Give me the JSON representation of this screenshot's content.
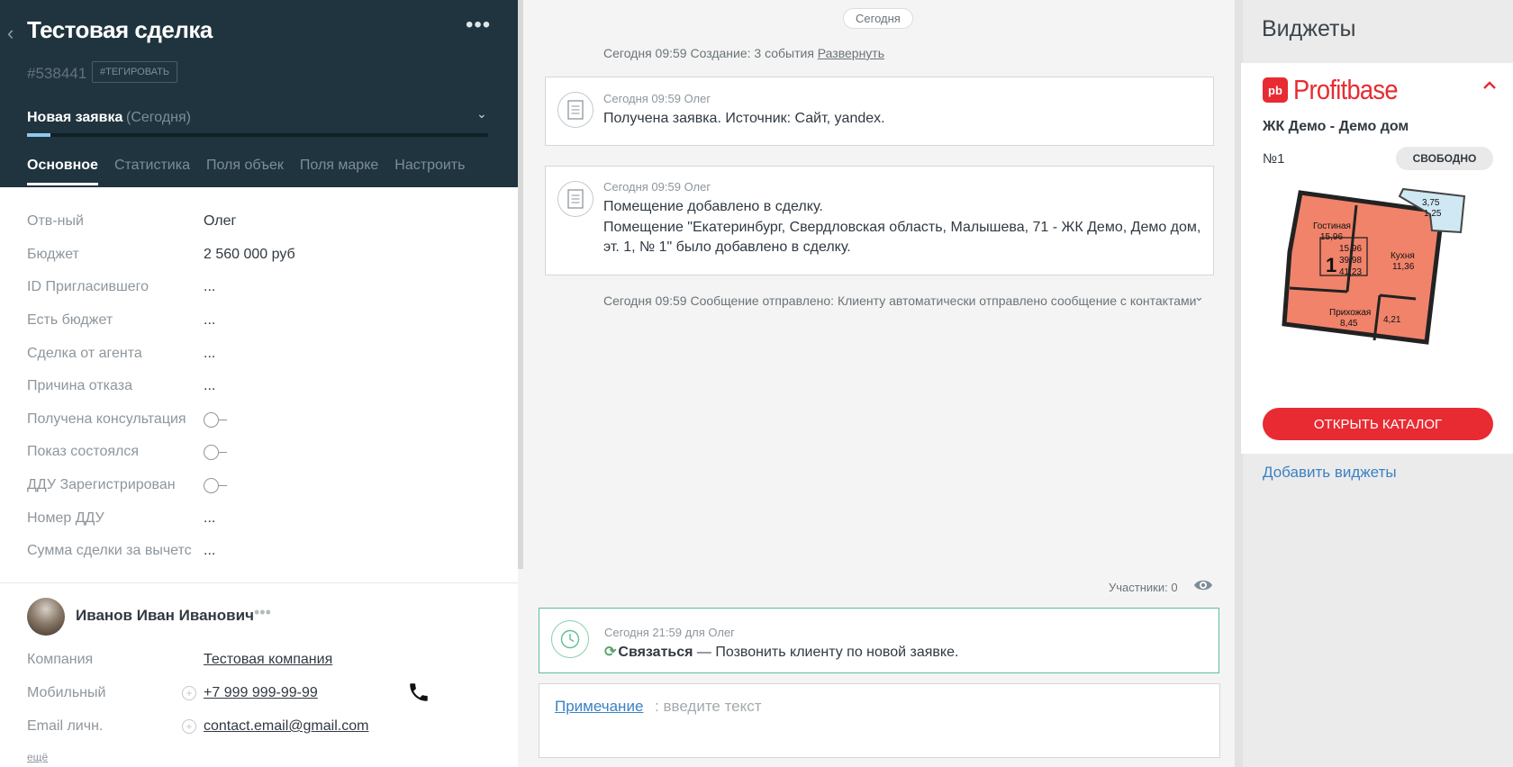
{
  "deal": {
    "back_icon": "chevron-left",
    "title": "Тестовая сделка",
    "menu": "•••",
    "id": "#538441",
    "tag_button": "#ТЕГИРОВАТЬ",
    "stage": "Новая заявка",
    "stage_date": "(Сегодня)",
    "stage_progress": 0.05
  },
  "tabs": [
    {
      "label": "Основное",
      "active": true
    },
    {
      "label": "Статистика",
      "active": false
    },
    {
      "label": "Поля объек",
      "active": false
    },
    {
      "label": "Поля марке",
      "active": false
    },
    {
      "label": "Настроить",
      "active": false
    }
  ],
  "fields": [
    {
      "label": "Отв-ный",
      "value": "Олег"
    },
    {
      "label": "Бюджет",
      "value": "2 560 000  руб"
    },
    {
      "label": "ID Пригласившего",
      "value": "..."
    },
    {
      "label": "Есть бюджет",
      "value": "..."
    },
    {
      "label": "Сделка от агента",
      "value": "..."
    },
    {
      "label": "Причина отказа",
      "value": "..."
    },
    {
      "label": "Получена консультация",
      "value": "toggle-off"
    },
    {
      "label": "Показ состоялся",
      "value": "toggle-off"
    },
    {
      "label": "ДДУ Зарегистрирован",
      "value": "toggle-off"
    },
    {
      "label": "Номер ДДУ",
      "value": "..."
    },
    {
      "label": "Сумма сделки за вычетс",
      "value": "..."
    }
  ],
  "contact": {
    "name": "Иванов Иван Иванович",
    "menu": "•••",
    "company_label": "Компания",
    "company": "Тестовая компания",
    "mobile_label": "Мобильный",
    "mobile": "+7 999 999-99-99",
    "email_label": "Email личн.",
    "email": "contact.email@gmail.com",
    "more": "ещё",
    "plus": "+"
  },
  "feed": {
    "today": "Сегодня",
    "creation": "Сегодня 09:59 Создание: 3 события",
    "expand": "Развернуть",
    "events": [
      {
        "meta": "Сегодня 09:59 Олег",
        "text": "Получена заявка. Источник: Сайт, yandex."
      },
      {
        "meta": "Сегодня 09:59 Олег",
        "text": "Помещение добавлено в сделку.\nПомещение \"Екатеринбург, Свердловская область, Малышева, 71 - ЖК Демо, Демо дом, эт. 1, № 1\" было добавлено в сделку."
      }
    ],
    "message_sent": "Сегодня 09:59 Сообщение отправлено: Клиенту автоматически отправлено сообщение с контактами",
    "participants": "Участники: 0",
    "task": {
      "meta": "Сегодня 21:59 для Олег",
      "type": "Связаться",
      "text": " — Позвонить клиенту по новой заявке."
    },
    "note_link": "Примечание",
    "note_placeholder": ": введите текст"
  },
  "widgets": {
    "title": "Виджеты",
    "profitbase": {
      "mark": "pb",
      "name": "Profitbase",
      "complex": "ЖК Демо - Демо дом",
      "number": "№1",
      "status": "СВОБОДНО",
      "open_catalog": "ОТКРЫТЬ КАТАЛОГ",
      "plan_rooms": {
        "living": "Гостиная",
        "living_area": "15,96",
        "kitchen": "Кухня",
        "kitchen_area": "11,36",
        "hall": "Прихожая",
        "hall_area": "8,45",
        "bath_area": "4,21",
        "balcony_area_1": "3,75",
        "balcony_area_2": "1,25",
        "rooms_count": "1",
        "area_living": "15,96",
        "area_total": "39,98",
        "area_full": "41,23"
      }
    },
    "add_widgets": "Добавить виджеты"
  },
  "colors": {
    "header_bg": "#20343f",
    "profitbase_red": "#e82b32",
    "link_blue": "#3a82c4",
    "task_green": "#5ebf94",
    "plan_fill": "#f0836a"
  }
}
